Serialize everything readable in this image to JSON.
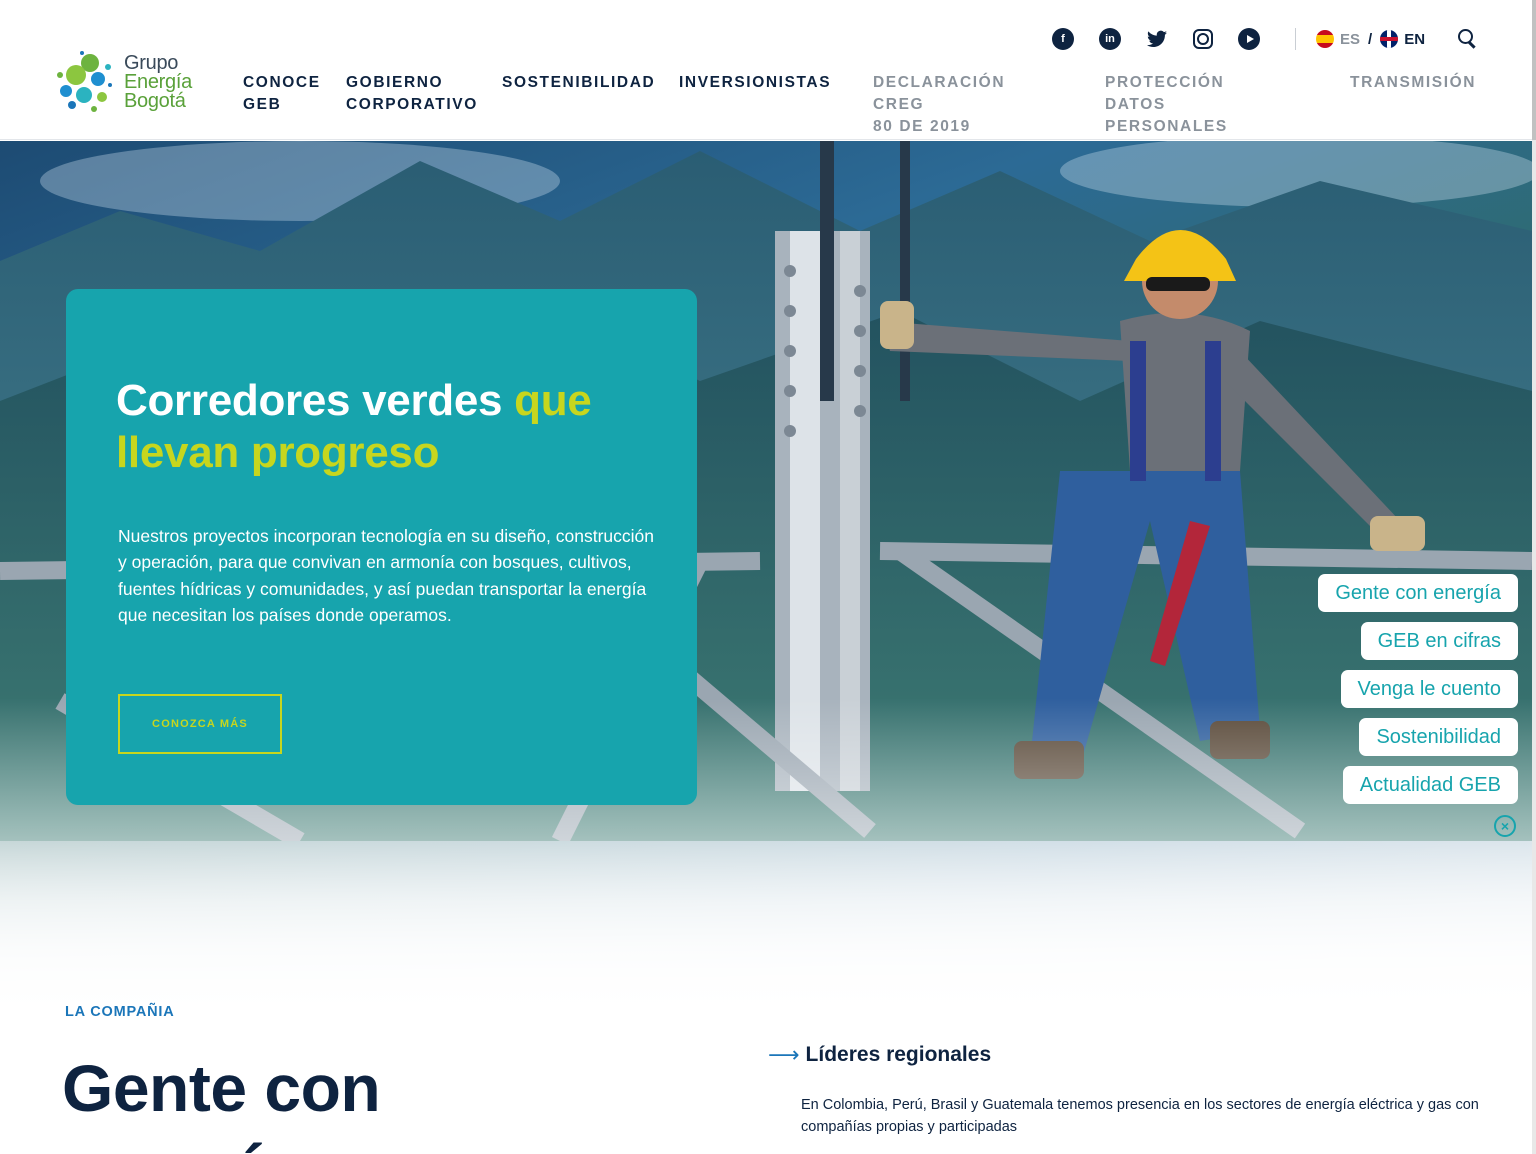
{
  "logo": {
    "line1": "Grupo",
    "line2": "Energía",
    "line3": "Bogotá"
  },
  "nav": [
    {
      "label": "CONOCE\nGEB"
    },
    {
      "label": "GOBIERNO\nCORPORATIVO"
    },
    {
      "label": "SOSTENIBILIDAD"
    },
    {
      "label": "INVERSIONISTAS"
    },
    {
      "label": "DECLARACIÓN CREG\n80 DE 2019"
    },
    {
      "label": "PROTECCIÓN DATOS\nPERSONALES"
    },
    {
      "label": "TRANSMISIÓN"
    }
  ],
  "social": {
    "facebook": "f",
    "linkedin": "in",
    "twitter": "🐦"
  },
  "lang": {
    "es": "ES",
    "sep": "/",
    "en": "EN"
  },
  "hero": {
    "title_part1": "Corredores verdes ",
    "title_highlight": "que llevan progreso",
    "body": "Nuestros proyectos incorporan tecnología en su diseño, construcción y operación, para que convivan en armonía con bosques, cultivos, fuentes hídricas y comunidades, y así puedan transportar la energía que necesitan los países donde operamos.",
    "cta": "CONOZCA MÁS"
  },
  "side_links": [
    "Gente con energía",
    "GEB en cifras",
    "Venga le cuento",
    "Sostenibilidad",
    "Actualidad GEB"
  ],
  "close_symbol": "×",
  "company": {
    "label": "LA COMPAÑIA",
    "title_line1": "Gente con",
    "title_line2": "energía",
    "leaders_title": "Líderes regionales",
    "leaders_arrow": "⟶",
    "leaders_text": "En Colombia, Perú, Brasil y Guatemala tenemos presencia en los sectores de energía eléctrica y gas con compañías propias y participadas"
  },
  "colors": {
    "teal": "#17a4ad",
    "lime": "#c7d61e",
    "navy": "#0e2340",
    "blue": "#1b76b9"
  }
}
